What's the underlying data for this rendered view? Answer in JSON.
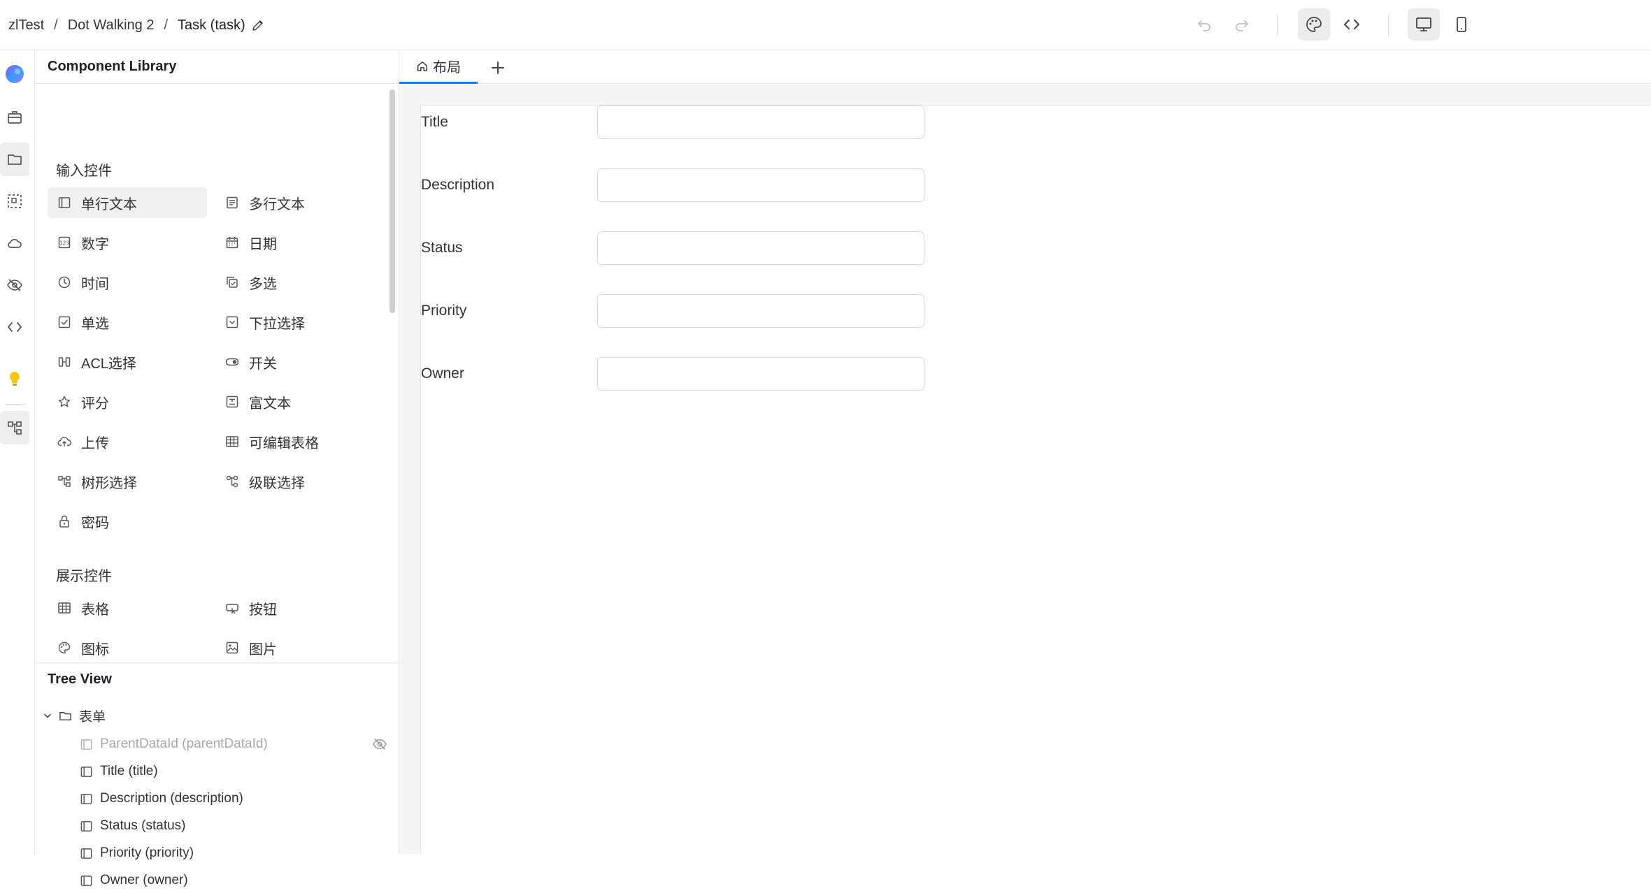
{
  "header": {
    "breadcrumb": [
      "zlTest",
      "Dot Walking 2",
      "Task (task)"
    ],
    "separator": "/"
  },
  "library": {
    "title": "Component Library",
    "groups": [
      {
        "title": "输入控件",
        "items": [
          {
            "label": "单行文本",
            "icon": "single-line-text-icon"
          },
          {
            "label": "多行文本",
            "icon": "multi-line-text-icon"
          },
          {
            "label": "数字",
            "icon": "number-icon"
          },
          {
            "label": "日期",
            "icon": "calendar-icon"
          },
          {
            "label": "时间",
            "icon": "clock-icon"
          },
          {
            "label": "多选",
            "icon": "multi-select-icon"
          },
          {
            "label": "单选",
            "icon": "checkbox-icon"
          },
          {
            "label": "下拉选择",
            "icon": "dropdown-icon"
          },
          {
            "label": "ACL选择",
            "icon": "acl-icon"
          },
          {
            "label": "开关",
            "icon": "toggle-icon"
          },
          {
            "label": "评分",
            "icon": "star-icon"
          },
          {
            "label": "富文本",
            "icon": "rich-text-icon"
          },
          {
            "label": "上传",
            "icon": "upload-cloud-icon"
          },
          {
            "label": "可编辑表格",
            "icon": "table-icon"
          },
          {
            "label": "树形选择",
            "icon": "tree-icon"
          },
          {
            "label": "级联选择",
            "icon": "cascade-icon"
          },
          {
            "label": "密码",
            "icon": "lock-icon"
          }
        ]
      },
      {
        "title": "展示控件",
        "items": [
          {
            "label": "表格",
            "icon": "table-icon"
          },
          {
            "label": "按钮",
            "icon": "button-icon"
          },
          {
            "label": "图标",
            "icon": "palette-icon"
          },
          {
            "label": "图片",
            "icon": "image-icon"
          }
        ]
      }
    ]
  },
  "tree": {
    "title": "Tree View",
    "root": "表单",
    "items": [
      {
        "label": "ParentDataId (parentDataId)",
        "hidden": true
      },
      {
        "label": "Title (title)",
        "hidden": false
      },
      {
        "label": "Description (description)",
        "hidden": false
      },
      {
        "label": "Status (status)",
        "hidden": false
      },
      {
        "label": "Priority (priority)",
        "hidden": false
      },
      {
        "label": "Owner (owner)",
        "hidden": false
      }
    ]
  },
  "tabs": [
    {
      "label": "布局",
      "icon": "home-icon",
      "active": true
    }
  ],
  "form": {
    "fields": [
      {
        "label": "Title",
        "value": ""
      },
      {
        "label": "Description",
        "value": ""
      },
      {
        "label": "Status",
        "value": ""
      },
      {
        "label": "Priority",
        "value": ""
      },
      {
        "label": "Owner",
        "value": ""
      }
    ]
  },
  "colors": {
    "accent": "#1677ff",
    "border": "#d9d9d9",
    "canvas_background": "#f5f5f5",
    "hint_bulb": "#f5c518"
  }
}
